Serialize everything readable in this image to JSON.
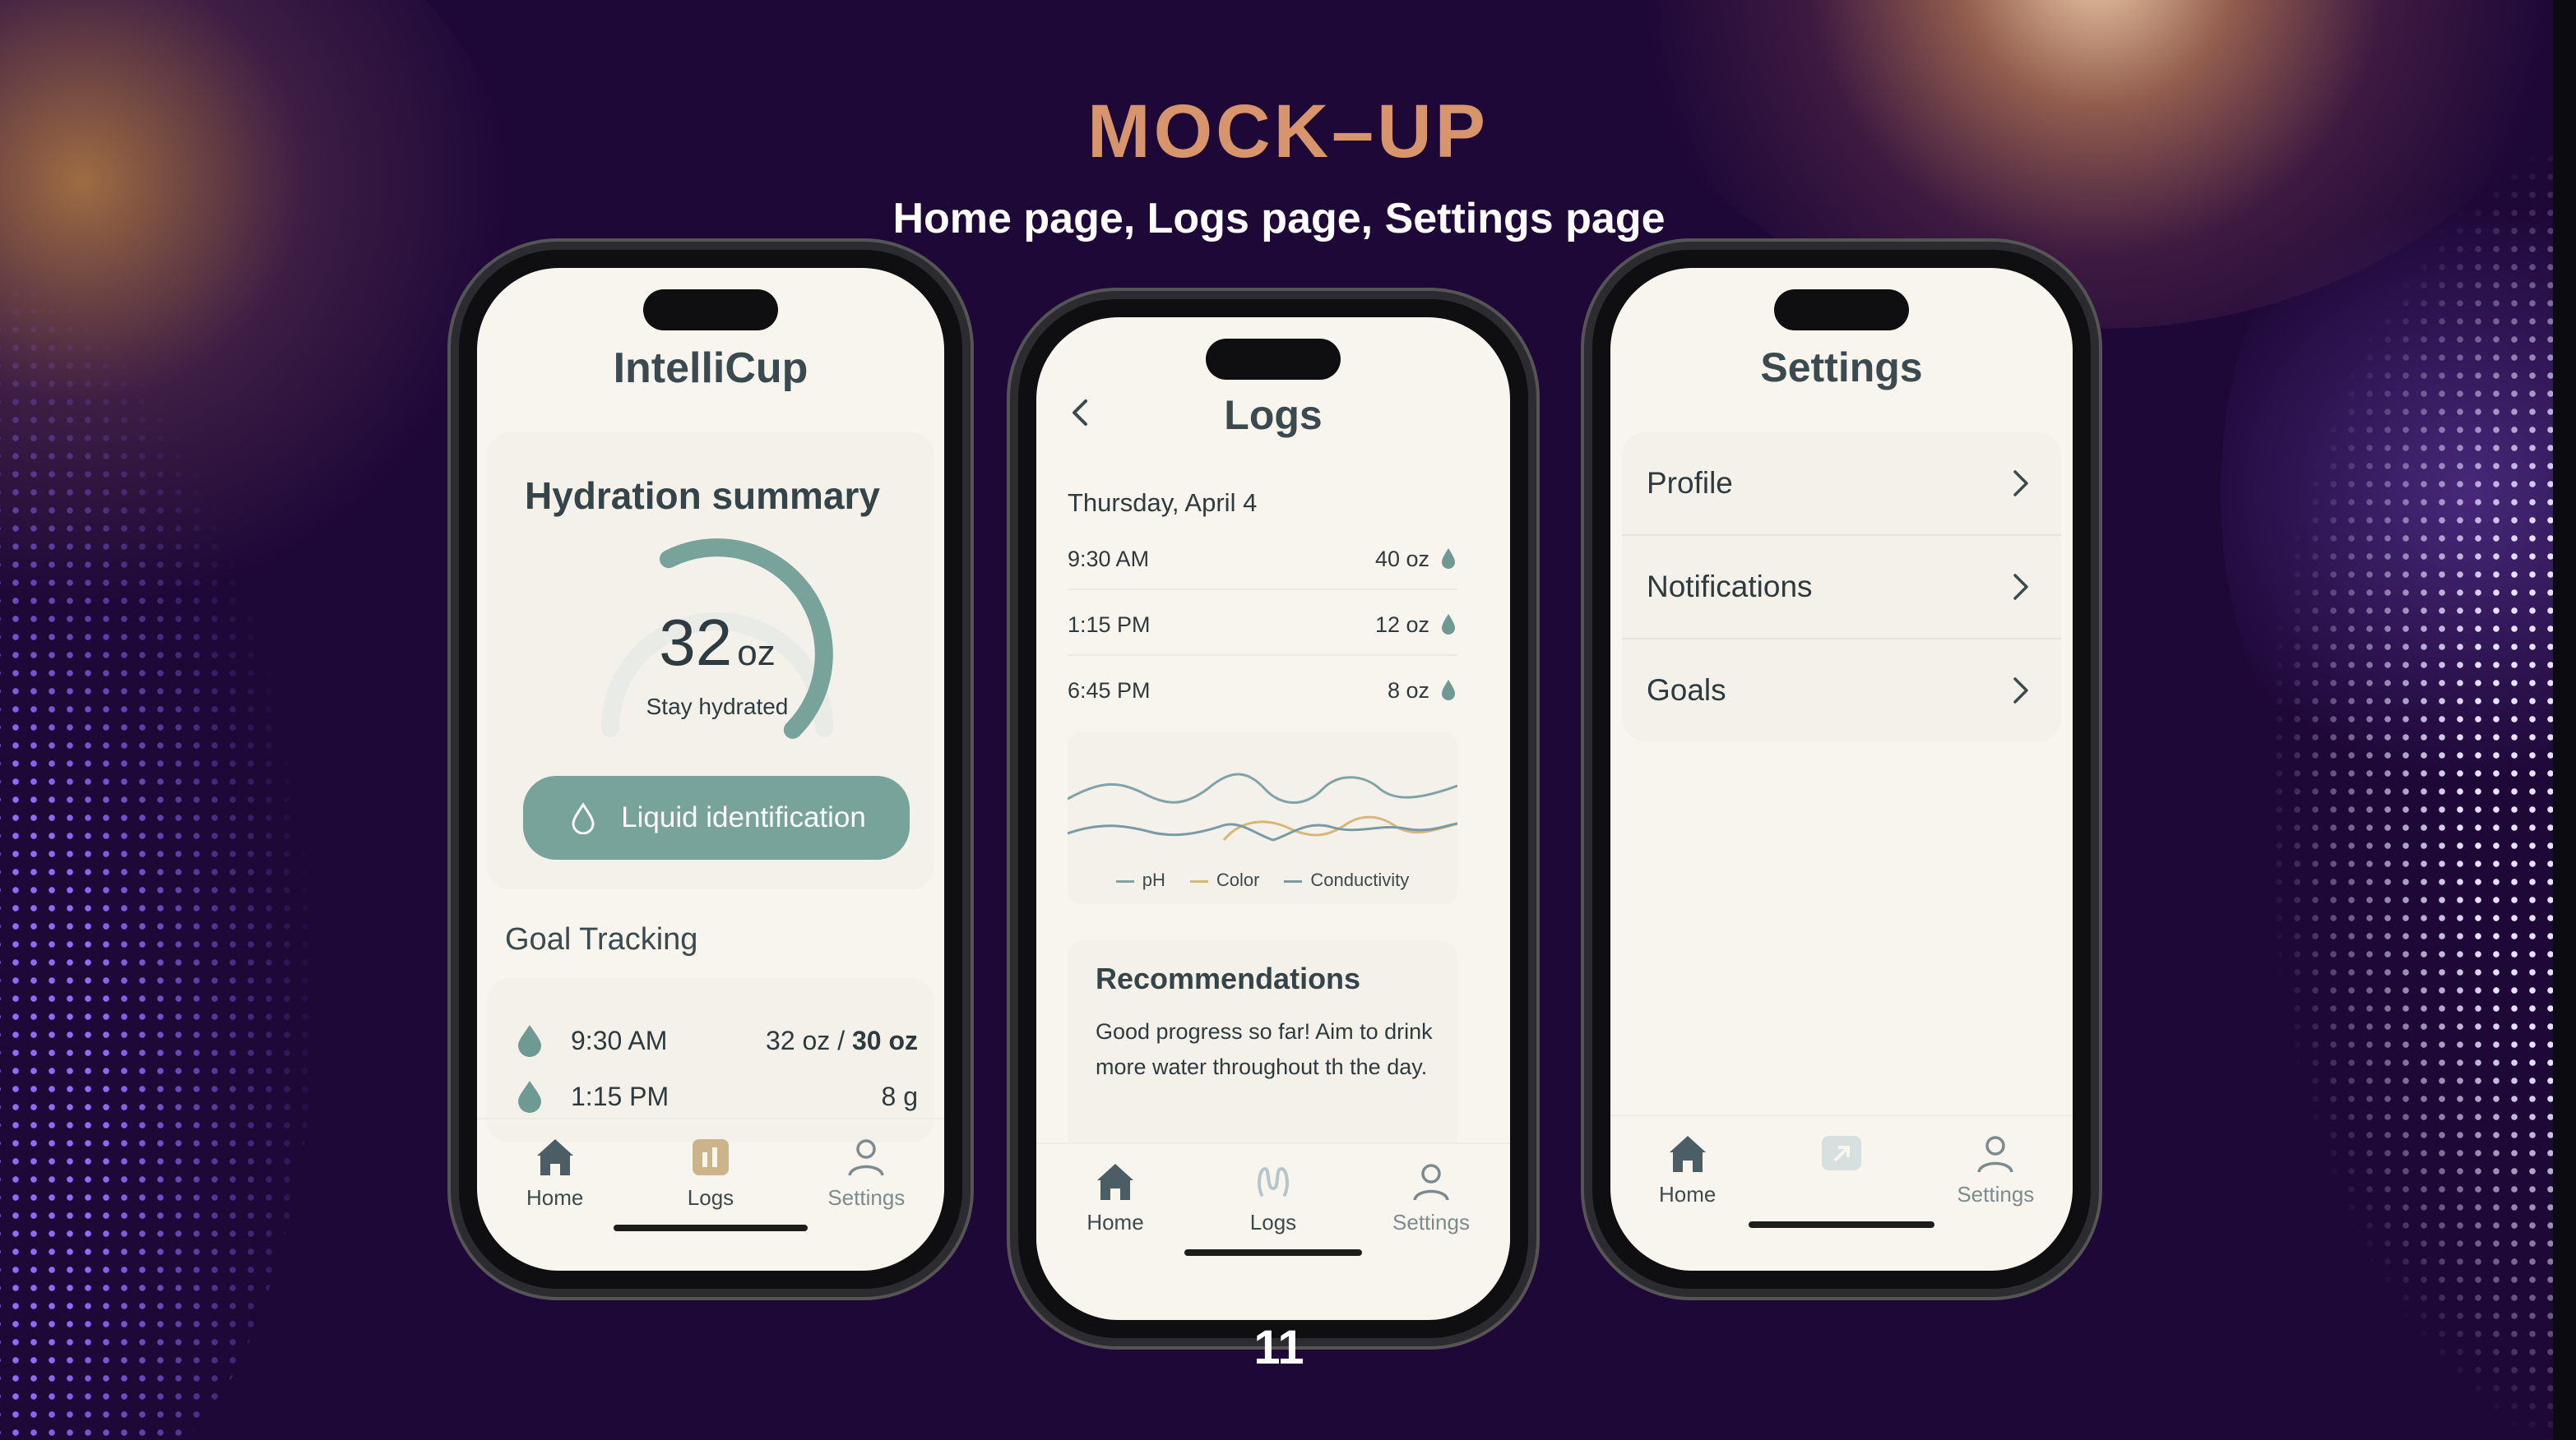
{
  "slide": {
    "title": "MOCK–UP",
    "subtitle": "Home page, Logs page, Settings page",
    "page_number": "11"
  },
  "home": {
    "app_title": "IntelliCup",
    "summary_title": "Hydration summary",
    "gauge_value": "32",
    "gauge_unit": "oz",
    "gauge_caption": "Stay hydrated",
    "gauge_fill_fraction": 0.6,
    "liquid_button": "Liquid identification",
    "goal_title": "Goal Tracking",
    "goal_rows": [
      {
        "time": "9:30 AM",
        "amount": "32 oz",
        "separator": "/",
        "goal": "30 oz"
      },
      {
        "time": "1:15 PM",
        "amount": "8 g"
      }
    ],
    "tabs": [
      {
        "label": "Home",
        "icon": "home-icon"
      },
      {
        "label": "Logs",
        "icon": "logs-icon"
      },
      {
        "label": "Settings",
        "icon": "user-icon"
      }
    ]
  },
  "logs": {
    "app_title": "Logs",
    "date": "Thursday, April 4",
    "entries": [
      {
        "time": "9:30 AM",
        "amount": "40 oz"
      },
      {
        "time": "1:15 PM",
        "amount": "12 oz"
      },
      {
        "time": "6:45 PM",
        "amount": "8 oz"
      }
    ],
    "legend": [
      {
        "name": "pH",
        "color": "#7fa3a8"
      },
      {
        "name": "Color",
        "color": "#d9b77a"
      },
      {
        "name": "Conductivity",
        "color": "#7a9aa6"
      }
    ],
    "recommendations_title": "Recommendations",
    "recommendations_text": "Good progress so far! Aim to drink more water throughout th the day.",
    "tabs": [
      {
        "label": "Home",
        "icon": "home-icon"
      },
      {
        "label": "Logs",
        "icon": "logs-icon"
      },
      {
        "label": "Settings",
        "icon": "user-icon"
      }
    ]
  },
  "settings": {
    "app_title": "Settings",
    "items": [
      {
        "label": "Profile"
      },
      {
        "label": "Notifications"
      },
      {
        "label": "Goals"
      }
    ],
    "tabs": [
      {
        "label": "Home",
        "icon": "home-icon"
      },
      {
        "label": "",
        "icon": "image-icon"
      },
      {
        "label": "Settings",
        "icon": "user-icon"
      }
    ]
  },
  "colors": {
    "accent": "#77a39a",
    "background": "#1e0838",
    "title": "#d8946a",
    "screen": "#f7f5ee"
  }
}
